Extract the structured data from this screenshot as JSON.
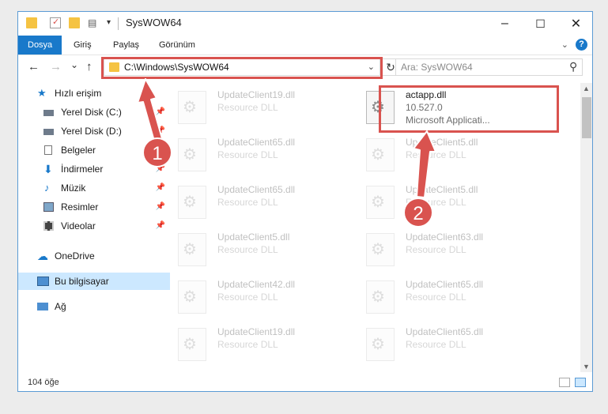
{
  "window": {
    "title": "SysWOW64",
    "minimize_glyph": "–",
    "maximize_glyph": "☐",
    "close_glyph": "✕"
  },
  "ribbon": {
    "tabs": [
      {
        "label": "Dosya",
        "active": true
      },
      {
        "label": "Giriş",
        "active": false
      },
      {
        "label": "Paylaş",
        "active": false
      },
      {
        "label": "Görünüm",
        "active": false
      }
    ],
    "help_glyph": "?"
  },
  "navigation": {
    "back_glyph": "←",
    "forward_glyph": "→",
    "recent_glyph": "⌄",
    "up_glyph": "↑",
    "address": "C:\\Windows\\SysWOW64",
    "refresh_glyph": "↻",
    "search_placeholder": "Ara: SysWOW64"
  },
  "sidebar": {
    "items": [
      {
        "label": "Hızlı erişim",
        "icon": "star-icon",
        "pinned": false
      },
      {
        "label": "Yerel Disk (C:)",
        "icon": "drive-icon",
        "pinned": true
      },
      {
        "label": "Yerel Disk (D:)",
        "icon": "drive-icon",
        "pinned": true
      },
      {
        "label": "Belgeler",
        "icon": "documents-icon",
        "pinned": true
      },
      {
        "label": "İndirmeler",
        "icon": "download-icon",
        "pinned": true
      },
      {
        "label": "Müzik",
        "icon": "music-icon",
        "pinned": true
      },
      {
        "label": "Resimler",
        "icon": "pictures-icon",
        "pinned": true
      },
      {
        "label": "Videolar",
        "icon": "videos-icon",
        "pinned": true
      },
      {
        "label": "OneDrive",
        "icon": "cloud-icon",
        "pinned": false
      },
      {
        "label": "Bu bilgisayar",
        "icon": "computer-icon",
        "pinned": false,
        "selected": true
      },
      {
        "label": "Ağ",
        "icon": "network-icon",
        "pinned": false
      }
    ]
  },
  "files": {
    "highlighted": {
      "name": "actapp.dll",
      "version": "10.527.0",
      "company": "Microsoft Applicati..."
    },
    "left_column": [
      {
        "name": "UpdateClient19.dll",
        "type": "Resource DLL"
      },
      {
        "name": "UpdateClient65.dll",
        "type": "Resource DLL"
      },
      {
        "name": "UpdateClient65.dll",
        "type": "Resource DLL"
      },
      {
        "name": "UpdateClient5.dll",
        "type": "Resource DLL"
      },
      {
        "name": "UpdateClient42.dll",
        "type": "Resource DLL"
      },
      {
        "name": "UpdateClient19.dll",
        "type": "Resource DLL"
      }
    ],
    "right_column": [
      {
        "name": "UpdateClient5.dll",
        "type": "Resource DLL"
      },
      {
        "name": "UpdateClient5.dll",
        "type": "Resource DLL"
      },
      {
        "name": "UpdateClient63.dll",
        "type": "Resource DLL"
      },
      {
        "name": "UpdateClient65.dll",
        "type": "Resource DLL"
      },
      {
        "name": "UpdateClient65.dll",
        "type": "Resource DLL"
      }
    ]
  },
  "annotations": {
    "badge_1": "1",
    "badge_2": "2",
    "accent_color": "#d9534f"
  },
  "status": {
    "item_count": "104 öğe"
  },
  "colors": {
    "ribbon_active": "#1979ca",
    "selection": "#cce8ff",
    "folder": "#f5c342"
  }
}
